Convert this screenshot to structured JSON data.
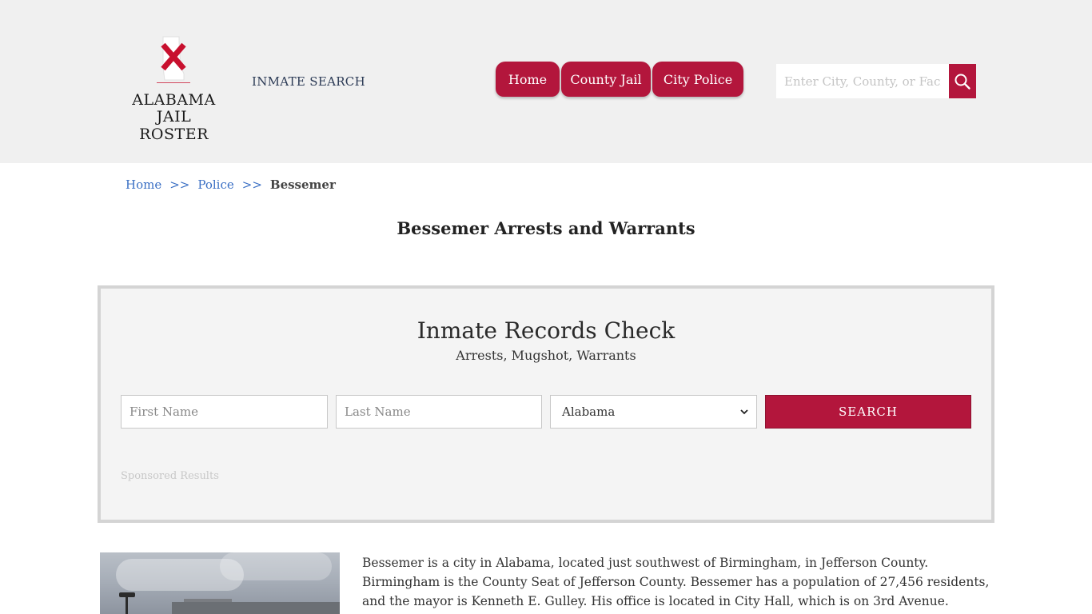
{
  "header": {
    "logo_line1": "ALABAMA",
    "logo_line2": "JAIL ROSTER",
    "inmate_search_label": "INMATE SEARCH",
    "nav": [
      {
        "label": "Home"
      },
      {
        "label": "County Jail"
      },
      {
        "label": "City Police"
      }
    ],
    "search_placeholder": "Enter City, County, or Facility",
    "search_icon": "magnifier-icon"
  },
  "breadcrumb": {
    "home": "Home",
    "sep": ">>",
    "police": "Police",
    "current": "Bessemer"
  },
  "page_title": "Bessemer Arrests and Warrants",
  "records_panel": {
    "title": "Inmate Records Check",
    "subtitle": "Arrests, Mugshot, Warrants",
    "first_name_placeholder": "First Name",
    "last_name_placeholder": "Last Name",
    "state_selected": "Alabama",
    "search_button": "SEARCH",
    "sponsored": "Sponsored Results"
  },
  "description": "Bessemer is a city in Alabama, located just southwest of Birmingham, in Jefferson County. Birmingham is the County Seat of Jefferson County. Bessemer has a population of 27,456 residents, and the mayor is Kenneth E. Gulley. His office is located in City Hall, which is on 3rd Avenue.",
  "colors": {
    "accent": "#b3163c",
    "header_bg": "#f0f0f0",
    "link": "#3a6fc4"
  }
}
